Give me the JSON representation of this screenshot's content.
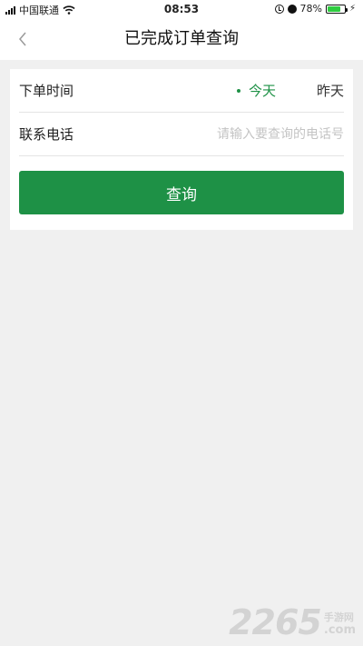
{
  "status_bar": {
    "carrier": "中国联通",
    "time": "08:53",
    "battery": "78%",
    "battery_level": 0.78,
    "icons": [
      "signal-icon",
      "wifi-icon",
      "rotation-lock-icon",
      "alarm-icon",
      "battery-icon",
      "charging-icon"
    ]
  },
  "nav": {
    "title": "已完成订单查询",
    "back_icon": "chevron-left-icon"
  },
  "form": {
    "date_label": "下单时间",
    "date_options": [
      "今天",
      "昨天"
    ],
    "selected_date": "今天",
    "phone_label": "联系电话",
    "phone_value": "",
    "phone_placeholder": "请输入要查询的电话号",
    "query_button": "查询"
  },
  "watermark": {
    "number": "2265",
    "text": "手游网",
    "suffix": ".com"
  },
  "colors": {
    "accent": "#1e9146",
    "background": "#f0f0f0",
    "card": "#ffffff"
  }
}
